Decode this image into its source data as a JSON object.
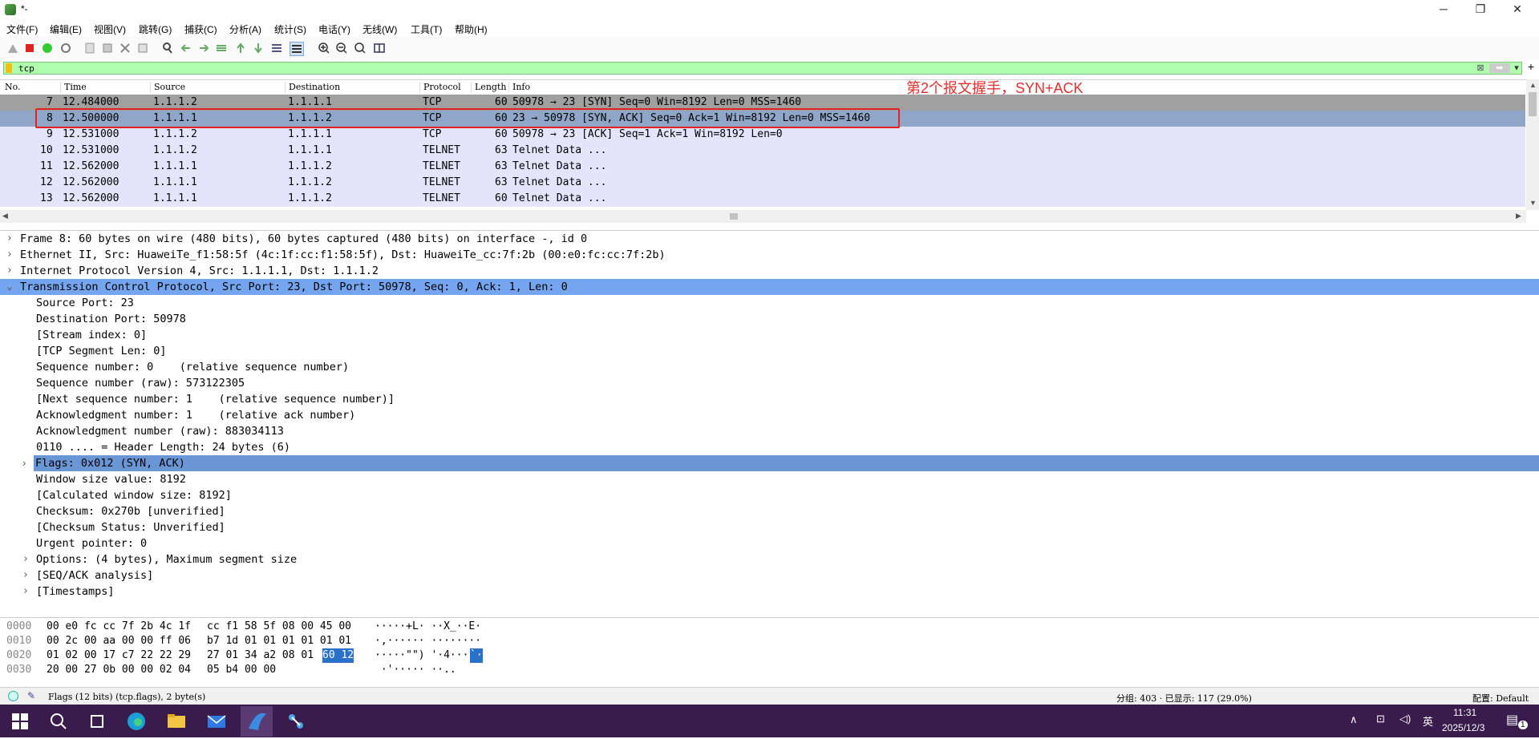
{
  "window": {
    "title": "*-"
  },
  "menu": [
    "文件(F)",
    "编辑(E)",
    "视图(V)",
    "跳转(G)",
    "捕获(C)",
    "分析(A)",
    "统计(S)",
    "电话(Y)",
    "无线(W)",
    "工具(T)",
    "帮助(H)"
  ],
  "filter": {
    "value": "tcp"
  },
  "packet_list": {
    "columns": [
      "No.",
      "Time",
      "Source",
      "Destination",
      "Protocol",
      "Length",
      "Info"
    ],
    "rows": [
      {
        "no": "7",
        "time": "12.484000",
        "src": "1.1.1.2",
        "dst": "1.1.1.1",
        "proto": "TCP",
        "len": "60",
        "info": "50978 → 23 [SYN] Seq=0 Win=8192 Len=0 MSS=1460"
      },
      {
        "no": "8",
        "time": "12.500000",
        "src": "1.1.1.1",
        "dst": "1.1.1.2",
        "proto": "TCP",
        "len": "60",
        "info": "23 → 50978 [SYN, ACK] Seq=0 Ack=1 Win=8192 Len=0 MSS=1460"
      },
      {
        "no": "9",
        "time": "12.531000",
        "src": "1.1.1.2",
        "dst": "1.1.1.1",
        "proto": "TCP",
        "len": "60",
        "info": "50978 → 23 [ACK] Seq=1 Ack=1 Win=8192 Len=0"
      },
      {
        "no": "10",
        "time": "12.531000",
        "src": "1.1.1.2",
        "dst": "1.1.1.1",
        "proto": "TELNET",
        "len": "63",
        "info": "Telnet Data ..."
      },
      {
        "no": "11",
        "time": "12.562000",
        "src": "1.1.1.1",
        "dst": "1.1.1.2",
        "proto": "TELNET",
        "len": "63",
        "info": "Telnet Data ..."
      },
      {
        "no": "12",
        "time": "12.562000",
        "src": "1.1.1.1",
        "dst": "1.1.1.2",
        "proto": "TELNET",
        "len": "63",
        "info": "Telnet Data ..."
      },
      {
        "no": "13",
        "time": "12.562000",
        "src": "1.1.1.1",
        "dst": "1.1.1.2",
        "proto": "TELNET",
        "len": "60",
        "info": "Telnet Data ..."
      }
    ],
    "annotation": "第2个报文握手，SYN+ACK"
  },
  "details": [
    "Frame 8: 60 bytes on wire (480 bits), 60 bytes captured (480 bits) on interface -, id 0",
    "Ethernet II, Src: HuaweiTe_f1:58:5f (4c:1f:cc:f1:58:5f), Dst: HuaweiTe_cc:7f:2b (00:e0:fc:cc:7f:2b)",
    "Internet Protocol Version 4, Src: 1.1.1.1, Dst: 1.1.1.2",
    "Transmission Control Protocol, Src Port: 23, Dst Port: 50978, Seq: 0, Ack: 1, Len: 0",
    "Source Port: 23",
    "Destination Port: 50978",
    "[Stream index: 0]",
    "[TCP Segment Len: 0]",
    "Sequence number: 0    (relative sequence number)",
    "Sequence number (raw): 573122305",
    "[Next sequence number: 1    (relative sequence number)]",
    "Acknowledgment number: 1    (relative ack number)",
    "Acknowledgment number (raw): 883034113",
    "0110 .... = Header Length: 24 bytes (6)",
    "Flags: 0x012 (SYN, ACK)",
    "Window size value: 8192",
    "[Calculated window size: 8192]",
    "Checksum: 0x270b [unverified]",
    "[Checksum Status: Unverified]",
    "Urgent pointer: 0",
    "Options: (4 bytes), Maximum segment size",
    "[SEQ/ACK analysis]",
    "[Timestamps]"
  ],
  "bytes": [
    {
      "off": "0000",
      "hex_a": "00 e0 fc cc 7f 2b 4c 1f",
      "hex_b": "cc f1 58 5f 08 00 45 00",
      "ascii": "·····+L· ··X_··E·"
    },
    {
      "off": "0010",
      "hex_a": "00 2c 00 aa 00 00 ff 06",
      "hex_b": "b7 1d 01 01 01 01 01 01",
      "ascii": "·,······ ········"
    },
    {
      "off": "0020",
      "hex_a": "01 02 00 17 c7 22 22 29",
      "hex_b": "27 01 34 a2 08 01",
      "hex_hl": "60 12",
      "ascii": "·····\"\") '·4···",
      "ascii_hl": "`·"
    },
    {
      "off": "0030",
      "hex_a": "20 00 27 0b 00 00 02 04",
      "hex_b": "05 b4 00 00",
      "ascii": " ·'····· ··.."
    }
  ],
  "status": {
    "field": "Flags (12 bits) (tcp.flags), 2 byte(s)",
    "packets": "分组: 403 · 已显示: 117 (29.0%)",
    "profile": "配置: Default"
  },
  "taskbar": {
    "ime": "英",
    "time": "11:31",
    "date": "2025/12/3",
    "notif": "1"
  },
  "colors": {
    "annotation": "#e23030",
    "filter_ok": "#afffaf",
    "taskbar": "#3a1b4d"
  }
}
